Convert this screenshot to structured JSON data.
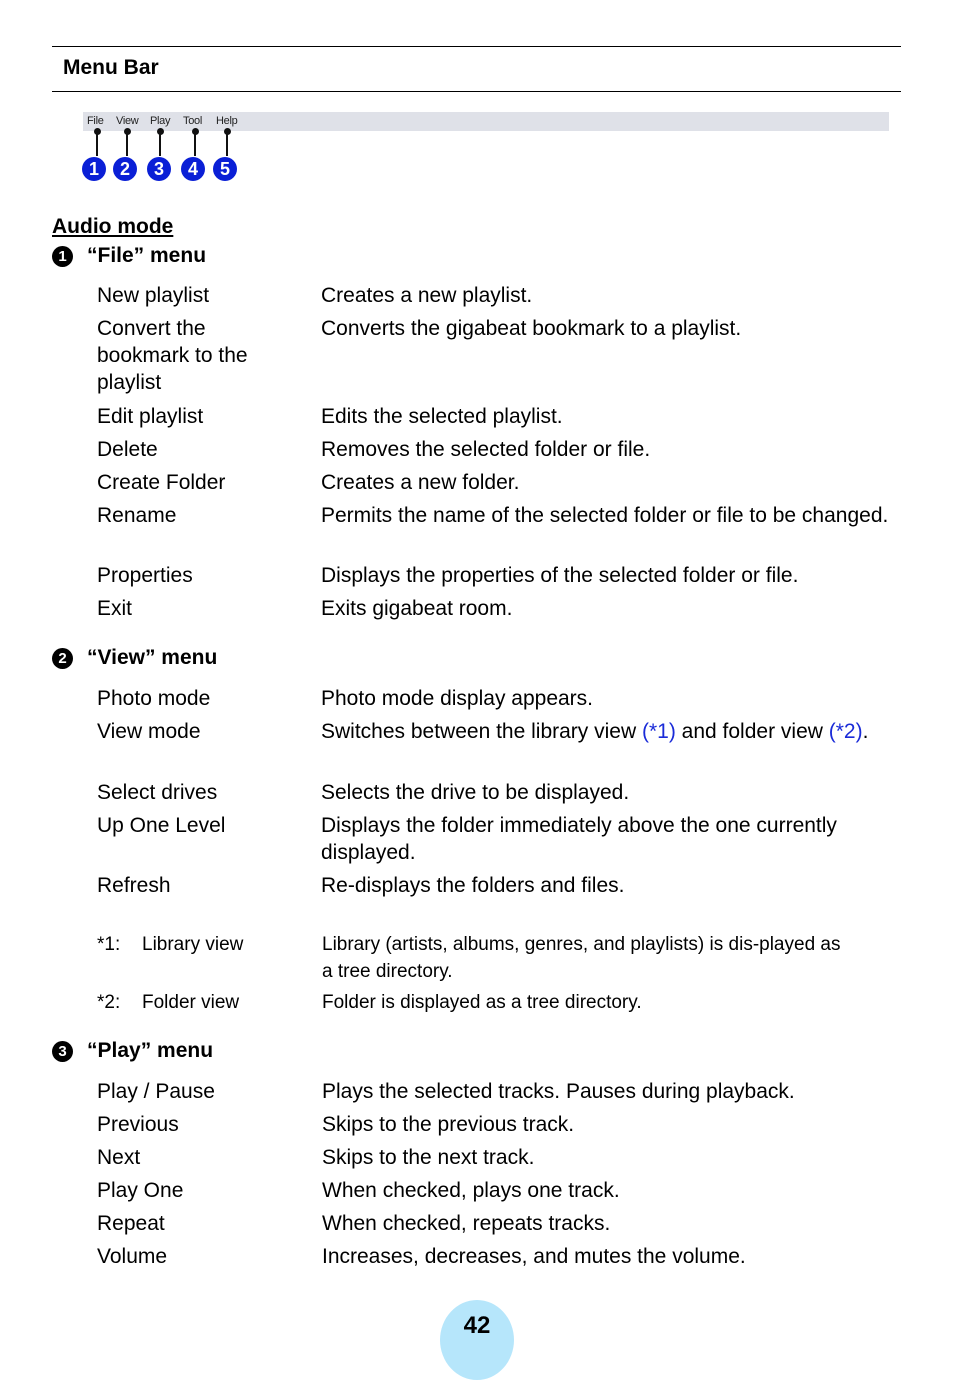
{
  "section_title": "Menu Bar",
  "menubar": {
    "items": [
      {
        "label": "File",
        "badge": "1"
      },
      {
        "label": "View",
        "badge": "2"
      },
      {
        "label": "Play",
        "badge": "3"
      },
      {
        "label": "Tool",
        "badge": "4"
      },
      {
        "label": "Help",
        "badge": "5"
      }
    ],
    "badge_color": "#0a1fd6",
    "bar_color": "#dfe1e8"
  },
  "mode_heading": "Audio mode",
  "file_menu": {
    "number": "1",
    "title": "“File” menu",
    "items": [
      {
        "term": "New playlist",
        "desc": "Creates a new playlist."
      },
      {
        "term": "Convert the bookmark to the playlist",
        "desc": "Converts the gigabeat bookmark to a playlist."
      },
      {
        "term": "Edit playlist",
        "desc": "Edits the selected playlist."
      },
      {
        "term": "Delete",
        "desc": "Removes the selected folder or file."
      },
      {
        "term": "Create Folder",
        "desc": "Creates a new folder."
      },
      {
        "term": "Rename",
        "desc": "Permits the name of the selected folder or file to be changed."
      },
      {
        "term": "Properties",
        "desc": "Displays the properties of the selected folder or file."
      },
      {
        "term": "Exit",
        "desc": "Exits gigabeat room."
      }
    ]
  },
  "view_menu": {
    "number": "2",
    "title": "“View” menu",
    "items": [
      {
        "term": "Photo mode",
        "desc": "Photo mode display appears."
      },
      {
        "term": "View mode",
        "desc_parts": [
          "Switches between the library view ",
          "(*1)",
          " and folder view ",
          "(*2)",
          "."
        ]
      },
      {
        "term": "Select drives",
        "desc": "Selects the drive to be displayed."
      },
      {
        "term": "Up One Level",
        "desc": "Displays the folder immediately above the one currently displayed."
      },
      {
        "term": "Refresh",
        "desc": "Re-displays the folders and files."
      }
    ],
    "notes": [
      {
        "mark": "*1:",
        "term": "Library view",
        "desc": "Library (artists, albums, genres, and playlists) is dis-played as a tree directory."
      },
      {
        "mark": "*2:",
        "term": "Folder view",
        "desc": "Folder is displayed as a tree directory."
      }
    ]
  },
  "play_menu": {
    "number": "3",
    "title": "“Play” menu",
    "items": [
      {
        "term": "Play / Pause",
        "desc": "Plays the selected tracks. Pauses during playback."
      },
      {
        "term": "Previous",
        "desc": "Skips to the previous track."
      },
      {
        "term": "Next",
        "desc": "Skips to the next track."
      },
      {
        "term": "Play One",
        "desc": "When checked, plays one track."
      },
      {
        "term": "Repeat",
        "desc": "When checked, repeats tracks."
      },
      {
        "term": "Volume",
        "desc": "Increases, decreases, and mutes the volume."
      }
    ]
  },
  "page_number": "42",
  "colors": {
    "link": "#1a2bd8",
    "page_badge": "#b6e6fb"
  }
}
